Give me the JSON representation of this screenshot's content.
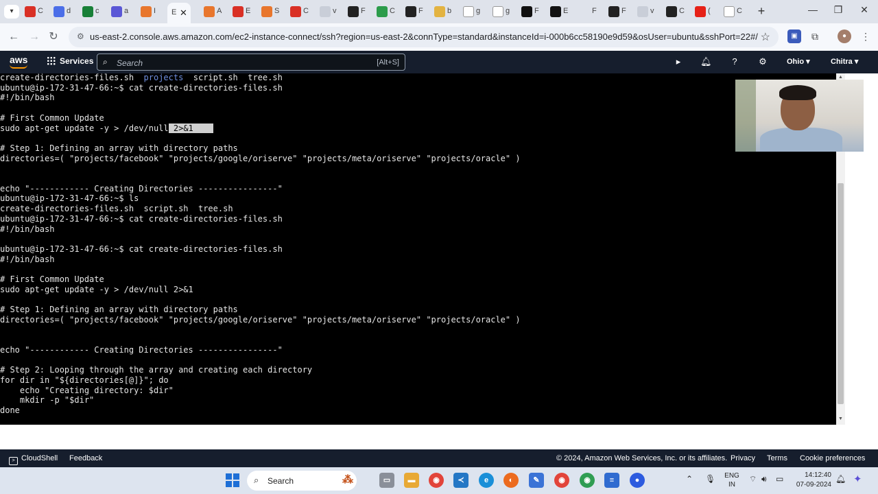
{
  "browser": {
    "tabs": [
      {
        "icon": "gmail-icon",
        "color": "#d93025",
        "label": "C"
      },
      {
        "icon": "docs-icon",
        "color": "#4b6ee8",
        "label": "d"
      },
      {
        "icon": "sheets-icon",
        "color": "#188038",
        "label": "c"
      },
      {
        "icon": "forms-icon",
        "color": "#5a57d6",
        "label": "a"
      },
      {
        "icon": "aws-icon",
        "color": "#e8762d",
        "label": "I"
      },
      {
        "icon": "terminal-icon",
        "color": "#f6f8fc",
        "label": "E",
        "active": true
      },
      {
        "icon": "aws-icon",
        "color": "#e8762d",
        "label": "A"
      },
      {
        "icon": "gmail-icon",
        "color": "#d93025",
        "label": "E"
      },
      {
        "icon": "aws-icon",
        "color": "#e8762d",
        "label": "S"
      },
      {
        "icon": "gmail-icon",
        "color": "#d93025",
        "label": "C"
      },
      {
        "icon": "blank-icon",
        "color": "#c9ced8",
        "label": "v"
      },
      {
        "icon": "github-icon",
        "color": "#222222",
        "label": "F"
      },
      {
        "icon": "drive-icon",
        "color": "#2c9c4b",
        "label": "C"
      },
      {
        "icon": "github-icon",
        "color": "#222222",
        "label": "F"
      },
      {
        "icon": "folder-icon",
        "color": "#e3b341",
        "label": "b"
      },
      {
        "icon": "google-icon",
        "color": "#ffffff",
        "label": "g"
      },
      {
        "icon": "google-icon",
        "color": "#ffffff",
        "label": "g"
      },
      {
        "icon": "notion-icon",
        "color": "#111111",
        "label": "F"
      },
      {
        "icon": "notion-icon",
        "color": "#111111",
        "label": "E"
      },
      {
        "icon": "history-icon",
        "color": "#dfe3eb",
        "label": "F"
      },
      {
        "icon": "github-icon",
        "color": "#222222",
        "label": "F"
      },
      {
        "icon": "blank-icon",
        "color": "#c9ced8",
        "label": "v"
      },
      {
        "icon": "github-icon",
        "color": "#222222",
        "label": "C"
      },
      {
        "icon": "youtube-icon",
        "color": "#e62117",
        "label": "("
      },
      {
        "icon": "openai-icon",
        "color": "#ffffff",
        "label": "C"
      }
    ],
    "url": "us-east-2.console.aws.amazon.com/ec2-instance-connect/ssh?region=us-east-2&connType=standard&instanceId=i-000b6cc58190e9d59&osUser=ubuntu&sshPort=22#/"
  },
  "aws_header": {
    "logo": "aws",
    "services_label": "Services",
    "search_placeholder": "Search",
    "search_shortcut": "[Alt+S]",
    "region": "Ohio ▾",
    "user": "Chitra ▾"
  },
  "terminal": {
    "lines": [
      [
        {
          "t": "create-directories-files.sh  "
        },
        {
          "t": "projects",
          "c": "blue"
        },
        {
          "t": "  script.sh  tree.sh"
        }
      ],
      [
        {
          "t": "ubuntu@ip-172-31-47-66:~$ cat create-directories-files.sh"
        }
      ],
      [
        {
          "t": "#!/bin/bash"
        }
      ],
      [
        {
          "t": ""
        }
      ],
      [
        {
          "t": "# First Common Update"
        }
      ],
      [
        {
          "t": "sudo apt-get update -y > /dev/null"
        },
        {
          "t": " 2>&1    ",
          "c": "sel"
        }
      ],
      [
        {
          "t": ""
        }
      ],
      [
        {
          "t": "# Step 1: Defining an array with directory paths"
        }
      ],
      [
        {
          "t": "directories=( \"projects/facebook\" \"projects/google/oriserve\" \"projects/meta/oriserve\" \"projects/oracle\" )"
        }
      ],
      [
        {
          "t": ""
        }
      ],
      [
        {
          "t": ""
        }
      ],
      [
        {
          "t": "echo \"------------ Creating Directories ----------------\""
        }
      ],
      [
        {
          "t": "ubuntu@ip-172-31-47-66:~$ ls"
        }
      ],
      [
        {
          "t": "create-directories-files.sh  script.sh  tree.sh"
        }
      ],
      [
        {
          "t": "ubuntu@ip-172-31-47-66:~$ cat create-directories-files.sh"
        }
      ],
      [
        {
          "t": "#!/bin/bash"
        }
      ],
      [
        {
          "t": ""
        }
      ],
      [
        {
          "t": "ubuntu@ip-172-31-47-66:~$ cat create-directories-files.sh"
        }
      ],
      [
        {
          "t": "#!/bin/bash"
        }
      ],
      [
        {
          "t": ""
        }
      ],
      [
        {
          "t": "# First Common Update"
        }
      ],
      [
        {
          "t": "sudo apt-get update -y > /dev/null 2>&1"
        }
      ],
      [
        {
          "t": ""
        }
      ],
      [
        {
          "t": "# Step 1: Defining an array with directory paths"
        }
      ],
      [
        {
          "t": "directories=( \"projects/facebook\" \"projects/google/oriserve\" \"projects/meta/oriserve\" \"projects/oracle\" )"
        }
      ],
      [
        {
          "t": ""
        }
      ],
      [
        {
          "t": ""
        }
      ],
      [
        {
          "t": "echo \"------------ Creating Directories ----------------\""
        }
      ],
      [
        {
          "t": ""
        }
      ],
      [
        {
          "t": "# Step 2: Looping through the array and creating each directory"
        }
      ],
      [
        {
          "t": "for dir in \"${directories[@]}\"; do"
        }
      ],
      [
        {
          "t": "    echo \"Creating directory: $dir\""
        }
      ],
      [
        {
          "t": "    mkdir -p \"$dir\""
        }
      ],
      [
        {
          "t": "done"
        }
      ]
    ]
  },
  "footer": {
    "cloudshell": "CloudShell",
    "feedback": "Feedback",
    "copyright": "© 2024, Amazon Web Services, Inc. or its affiliates.",
    "privacy": "Privacy",
    "terms": "Terms",
    "cookies": "Cookie preferences"
  },
  "taskbar": {
    "search_label": "Search",
    "lang_top": "ENG",
    "lang_bottom": "IN",
    "time": "14:12:40",
    "date": "07-09-2024"
  }
}
